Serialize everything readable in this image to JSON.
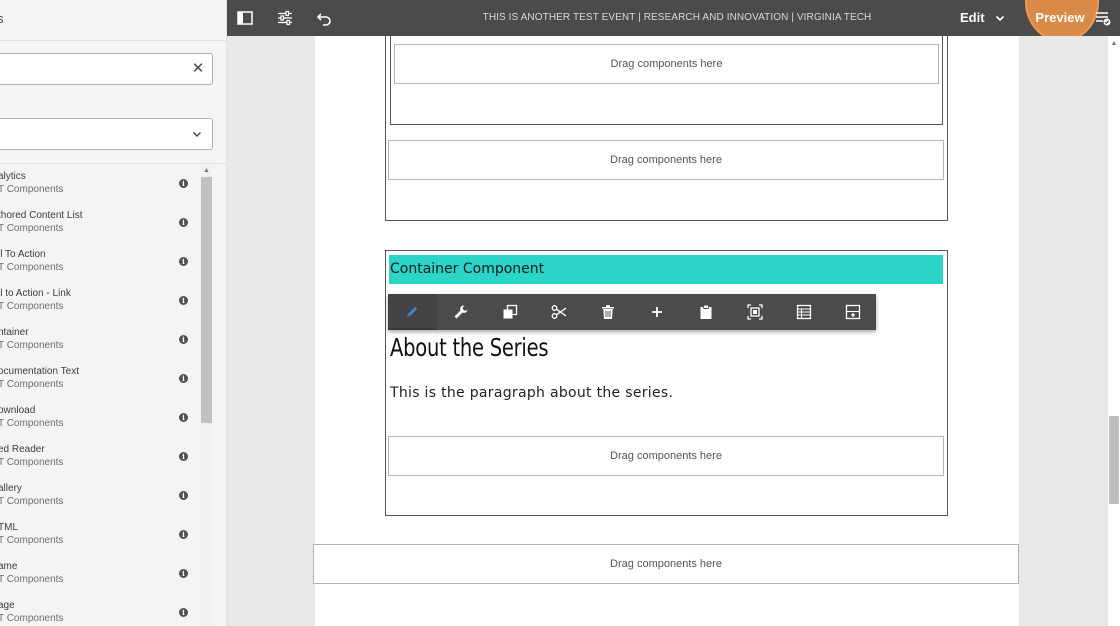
{
  "side_panel": {
    "title": "s",
    "search": {
      "value": "",
      "placeholder": ""
    },
    "group_select": {
      "value": ""
    },
    "components": [
      {
        "name": "alytics",
        "group": "T Components"
      },
      {
        "name": "thored Content List",
        "group": "T Components"
      },
      {
        "name": "ll To Action",
        "group": "T Components"
      },
      {
        "name": "ll to Action - Link",
        "group": "T Components"
      },
      {
        "name": "ntainer",
        "group": "T Components"
      },
      {
        "name": "ocumentation Text",
        "group": "T Components"
      },
      {
        "name": "ownload",
        "group": "T Components"
      },
      {
        "name": "ed Reader",
        "group": "T Components"
      },
      {
        "name": "allery",
        "group": "T Components"
      },
      {
        "name": "TML",
        "group": "T Components"
      },
      {
        "name": "ame",
        "group": "T Components"
      },
      {
        "name": "age",
        "group": "T Components"
      }
    ]
  },
  "toolbar": {
    "page_title": "THIS IS ANOTHER TEST EVENT | RESEARCH AND INNOVATION | VIRGINIA TECH",
    "mode_label": "Edit",
    "preview_label": "Preview"
  },
  "editor": {
    "drop_placeholder": "Drag components here",
    "container_label": "Container Component",
    "heading": "About the Series",
    "paragraph": "This is the paragraph about the series."
  },
  "component_toolbar": {
    "actions": [
      "edit",
      "configure",
      "copy",
      "cut",
      "delete",
      "insert",
      "paste",
      "layout",
      "group",
      "convert"
    ]
  },
  "colors": {
    "toolbar_bg": "#4b4b4b",
    "container_label_bg": "#2ad4c6",
    "preview_highlight": "#d98a47",
    "active_edit_icon": "#3f8bd6"
  }
}
